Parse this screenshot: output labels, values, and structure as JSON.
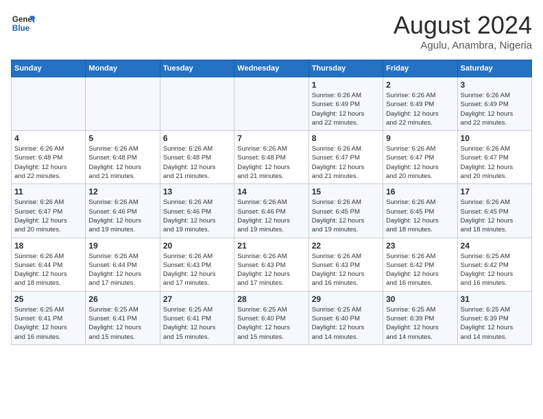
{
  "logo": {
    "line1": "General",
    "line2": "Blue"
  },
  "title": "August 2024",
  "subtitle": "Agulu, Anambra, Nigeria",
  "days_header": [
    "Sunday",
    "Monday",
    "Tuesday",
    "Wednesday",
    "Thursday",
    "Friday",
    "Saturday"
  ],
  "weeks": [
    [
      {
        "day": "",
        "info": ""
      },
      {
        "day": "",
        "info": ""
      },
      {
        "day": "",
        "info": ""
      },
      {
        "day": "",
        "info": ""
      },
      {
        "day": "1",
        "info": "Sunrise: 6:26 AM\nSunset: 6:49 PM\nDaylight: 12 hours\nand 22 minutes."
      },
      {
        "day": "2",
        "info": "Sunrise: 6:26 AM\nSunset: 6:49 PM\nDaylight: 12 hours\nand 22 minutes."
      },
      {
        "day": "3",
        "info": "Sunrise: 6:26 AM\nSunset: 6:49 PM\nDaylight: 12 hours\nand 22 minutes."
      }
    ],
    [
      {
        "day": "4",
        "info": "Sunrise: 6:26 AM\nSunset: 6:48 PM\nDaylight: 12 hours\nand 22 minutes."
      },
      {
        "day": "5",
        "info": "Sunrise: 6:26 AM\nSunset: 6:48 PM\nDaylight: 12 hours\nand 21 minutes."
      },
      {
        "day": "6",
        "info": "Sunrise: 6:26 AM\nSunset: 6:48 PM\nDaylight: 12 hours\nand 21 minutes."
      },
      {
        "day": "7",
        "info": "Sunrise: 6:26 AM\nSunset: 6:48 PM\nDaylight: 12 hours\nand 21 minutes."
      },
      {
        "day": "8",
        "info": "Sunrise: 6:26 AM\nSunset: 6:47 PM\nDaylight: 12 hours\nand 21 minutes."
      },
      {
        "day": "9",
        "info": "Sunrise: 6:26 AM\nSunset: 6:47 PM\nDaylight: 12 hours\nand 20 minutes."
      },
      {
        "day": "10",
        "info": "Sunrise: 6:26 AM\nSunset: 6:47 PM\nDaylight: 12 hours\nand 20 minutes."
      }
    ],
    [
      {
        "day": "11",
        "info": "Sunrise: 6:26 AM\nSunset: 6:47 PM\nDaylight: 12 hours\nand 20 minutes."
      },
      {
        "day": "12",
        "info": "Sunrise: 6:26 AM\nSunset: 6:46 PM\nDaylight: 12 hours\nand 19 minutes."
      },
      {
        "day": "13",
        "info": "Sunrise: 6:26 AM\nSunset: 6:46 PM\nDaylight: 12 hours\nand 19 minutes."
      },
      {
        "day": "14",
        "info": "Sunrise: 6:26 AM\nSunset: 6:46 PM\nDaylight: 12 hours\nand 19 minutes."
      },
      {
        "day": "15",
        "info": "Sunrise: 6:26 AM\nSunset: 6:45 PM\nDaylight: 12 hours\nand 19 minutes."
      },
      {
        "day": "16",
        "info": "Sunrise: 6:26 AM\nSunset: 6:45 PM\nDaylight: 12 hours\nand 18 minutes."
      },
      {
        "day": "17",
        "info": "Sunrise: 6:26 AM\nSunset: 6:45 PM\nDaylight: 12 hours\nand 18 minutes."
      }
    ],
    [
      {
        "day": "18",
        "info": "Sunrise: 6:26 AM\nSunset: 6:44 PM\nDaylight: 12 hours\nand 18 minutes."
      },
      {
        "day": "19",
        "info": "Sunrise: 6:26 AM\nSunset: 6:44 PM\nDaylight: 12 hours\nand 17 minutes."
      },
      {
        "day": "20",
        "info": "Sunrise: 6:26 AM\nSunset: 6:43 PM\nDaylight: 12 hours\nand 17 minutes."
      },
      {
        "day": "21",
        "info": "Sunrise: 6:26 AM\nSunset: 6:43 PM\nDaylight: 12 hours\nand 17 minutes."
      },
      {
        "day": "22",
        "info": "Sunrise: 6:26 AM\nSunset: 6:43 PM\nDaylight: 12 hours\nand 16 minutes."
      },
      {
        "day": "23",
        "info": "Sunrise: 6:26 AM\nSunset: 6:42 PM\nDaylight: 12 hours\nand 16 minutes."
      },
      {
        "day": "24",
        "info": "Sunrise: 6:25 AM\nSunset: 6:42 PM\nDaylight: 12 hours\nand 16 minutes."
      }
    ],
    [
      {
        "day": "25",
        "info": "Sunrise: 6:25 AM\nSunset: 6:41 PM\nDaylight: 12 hours\nand 16 minutes."
      },
      {
        "day": "26",
        "info": "Sunrise: 6:25 AM\nSunset: 6:41 PM\nDaylight: 12 hours\nand 15 minutes."
      },
      {
        "day": "27",
        "info": "Sunrise: 6:25 AM\nSunset: 6:41 PM\nDaylight: 12 hours\nand 15 minutes."
      },
      {
        "day": "28",
        "info": "Sunrise: 6:25 AM\nSunset: 6:40 PM\nDaylight: 12 hours\nand 15 minutes."
      },
      {
        "day": "29",
        "info": "Sunrise: 6:25 AM\nSunset: 6:40 PM\nDaylight: 12 hours\nand 14 minutes."
      },
      {
        "day": "30",
        "info": "Sunrise: 6:25 AM\nSunset: 6:39 PM\nDaylight: 12 hours\nand 14 minutes."
      },
      {
        "day": "31",
        "info": "Sunrise: 6:25 AM\nSunset: 6:39 PM\nDaylight: 12 hours\nand 14 minutes."
      }
    ]
  ]
}
